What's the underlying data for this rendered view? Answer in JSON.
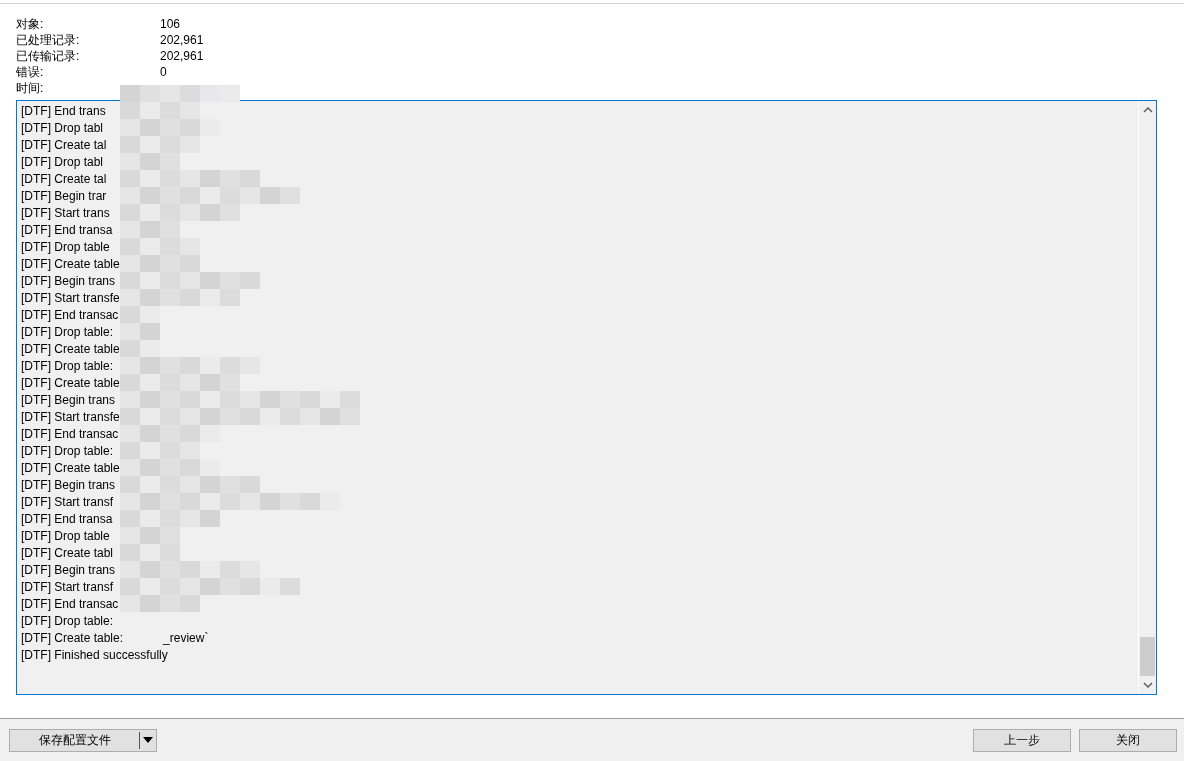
{
  "summary": [
    {
      "label": "对象:",
      "value": "106"
    },
    {
      "label": "已处理记录:",
      "value": "202,961"
    },
    {
      "label": "已传输记录:",
      "value": "202,961"
    },
    {
      "label": "错误:",
      "value": "0"
    },
    {
      "label": "时间:"
    }
  ],
  "log": [
    {
      "text": "[DTF] End trans"
    },
    {
      "text": "[DTF] Drop tabl"
    },
    {
      "text": "[DTF] Create tal"
    },
    {
      "text": "[DTF] Drop tabl"
    },
    {
      "text": "[DTF] Create tal"
    },
    {
      "text": "[DTF] Begin trar"
    },
    {
      "text": "[DTF] Start trans"
    },
    {
      "text": "[DTF] End transa"
    },
    {
      "text": "[DTF] Drop table"
    },
    {
      "text": "[DTF] Create table"
    },
    {
      "text": "[DTF] Begin trans"
    },
    {
      "text": "[DTF] Start transfe"
    },
    {
      "text": "[DTF] End transac"
    },
    {
      "text": "[DTF] Drop table:"
    },
    {
      "text": "[DTF] Create table"
    },
    {
      "text": "[DTF] Drop table:"
    },
    {
      "text": "[DTF] Create table"
    },
    {
      "text": "[DTF] Begin trans"
    },
    {
      "text": "[DTF] Start transfe"
    },
    {
      "text": "[DTF] End transac"
    },
    {
      "text": "[DTF] Drop table:"
    },
    {
      "text": "[DTF] Create table"
    },
    {
      "text": "[DTF] Begin trans"
    },
    {
      "text": "[DTF] Start transf"
    },
    {
      "text": "[DTF] End transa"
    },
    {
      "text": "[DTF] Drop table"
    },
    {
      "text": "[DTF] Create tabl"
    },
    {
      "text": "[DTF] Begin trans"
    },
    {
      "text": "[DTF] Start transf"
    },
    {
      "text": "[DTF] End transac"
    },
    {
      "text": "[DTF] Drop table:"
    },
    {
      "text": "[DTF] Create table:",
      "tail": "_review`"
    },
    {
      "text": "[DTF] Finished successfully"
    }
  ],
  "buttons": {
    "save": "保存配置文件",
    "back": "上一步",
    "close": "关闭"
  }
}
